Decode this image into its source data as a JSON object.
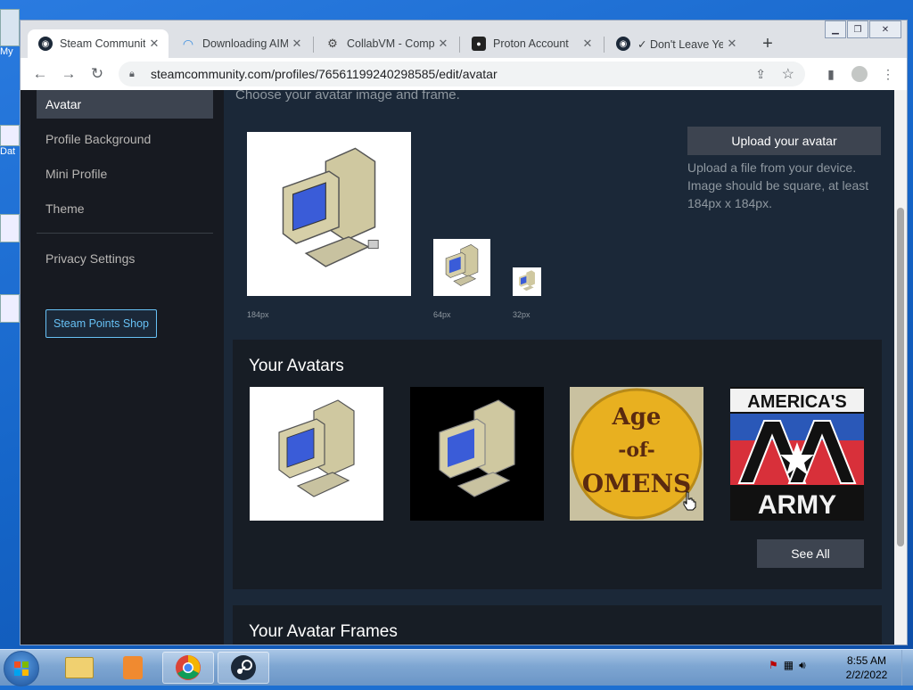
{
  "desktop": {
    "icon_labels": [
      "My",
      "Dat"
    ]
  },
  "browser": {
    "tabs": [
      {
        "title": "Steam Community",
        "active": true,
        "icon": "steam-icon"
      },
      {
        "title": "Downloading AIM",
        "active": false,
        "icon": "aim-icon"
      },
      {
        "title": "CollabVM - Comp",
        "active": false,
        "icon": "collabvm-icon"
      },
      {
        "title": "Proton Account",
        "active": false,
        "icon": "proton-icon"
      },
      {
        "title": "✓ Don't Leave Yet",
        "active": false,
        "icon": "steam-icon"
      }
    ],
    "new_tab_label": "+",
    "url": "steamcommunity.com/profiles/76561199240298585/edit/avatar"
  },
  "sidebar": {
    "items": [
      {
        "label": "Avatar",
        "active": true
      },
      {
        "label": "Profile Background",
        "active": false
      },
      {
        "label": "Mini Profile",
        "active": false
      },
      {
        "label": "Theme",
        "active": false
      }
    ],
    "privacy_label": "Privacy Settings",
    "points_shop_label": "Steam Points Shop"
  },
  "main": {
    "choose_text": "Choose your avatar image and frame.",
    "preview_sizes": [
      "184px",
      "64px",
      "32px"
    ],
    "upload_button": "Upload your avatar",
    "upload_help": "Upload a file from your device. Image should be square, at least 184px x 184px.",
    "your_avatars_title": "Your Avatars",
    "avatars": [
      {
        "name": "computer-white"
      },
      {
        "name": "computer-black"
      },
      {
        "name": "age-of-omens",
        "text": [
          "Age",
          "-of-",
          "OMENS"
        ]
      },
      {
        "name": "americas-army",
        "text": [
          "AMERICA'S",
          "ARMY"
        ]
      }
    ],
    "see_all_label": "See All",
    "your_frames_title": "Your Avatar Frames"
  },
  "taskbar": {
    "clock_time": "8:55 AM",
    "clock_date": "2/2/2022"
  },
  "colors": {
    "steam_bg": "#1b2838",
    "sidebar_bg": "#171a21",
    "accent_blue": "#67c1f5",
    "button_bg": "#3d4450"
  }
}
